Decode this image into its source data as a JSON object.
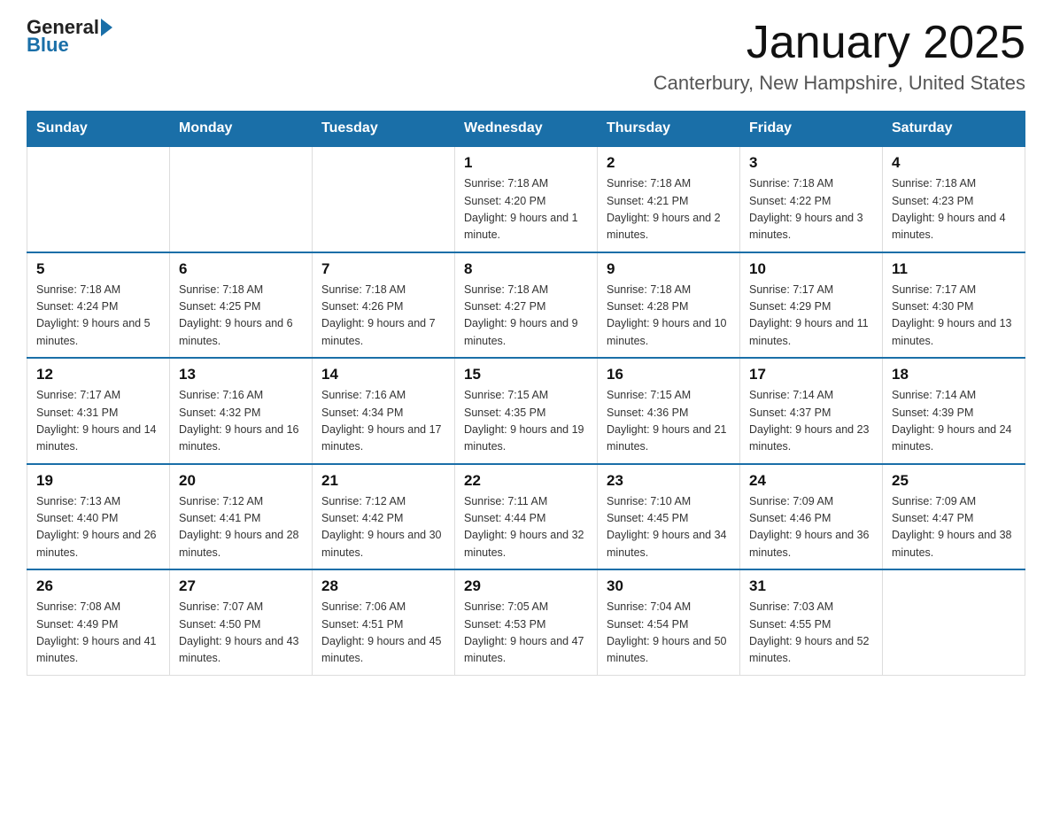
{
  "header": {
    "logo_text": "General",
    "logo_blue": "Blue",
    "title": "January 2025",
    "subtitle": "Canterbury, New Hampshire, United States"
  },
  "days_of_week": [
    "Sunday",
    "Monday",
    "Tuesday",
    "Wednesday",
    "Thursday",
    "Friday",
    "Saturday"
  ],
  "weeks": [
    [
      {
        "day": "",
        "info": ""
      },
      {
        "day": "",
        "info": ""
      },
      {
        "day": "",
        "info": ""
      },
      {
        "day": "1",
        "info": "Sunrise: 7:18 AM\nSunset: 4:20 PM\nDaylight: 9 hours and 1 minute."
      },
      {
        "day": "2",
        "info": "Sunrise: 7:18 AM\nSunset: 4:21 PM\nDaylight: 9 hours and 2 minutes."
      },
      {
        "day": "3",
        "info": "Sunrise: 7:18 AM\nSunset: 4:22 PM\nDaylight: 9 hours and 3 minutes."
      },
      {
        "day": "4",
        "info": "Sunrise: 7:18 AM\nSunset: 4:23 PM\nDaylight: 9 hours and 4 minutes."
      }
    ],
    [
      {
        "day": "5",
        "info": "Sunrise: 7:18 AM\nSunset: 4:24 PM\nDaylight: 9 hours and 5 minutes."
      },
      {
        "day": "6",
        "info": "Sunrise: 7:18 AM\nSunset: 4:25 PM\nDaylight: 9 hours and 6 minutes."
      },
      {
        "day": "7",
        "info": "Sunrise: 7:18 AM\nSunset: 4:26 PM\nDaylight: 9 hours and 7 minutes."
      },
      {
        "day": "8",
        "info": "Sunrise: 7:18 AM\nSunset: 4:27 PM\nDaylight: 9 hours and 9 minutes."
      },
      {
        "day": "9",
        "info": "Sunrise: 7:18 AM\nSunset: 4:28 PM\nDaylight: 9 hours and 10 minutes."
      },
      {
        "day": "10",
        "info": "Sunrise: 7:17 AM\nSunset: 4:29 PM\nDaylight: 9 hours and 11 minutes."
      },
      {
        "day": "11",
        "info": "Sunrise: 7:17 AM\nSunset: 4:30 PM\nDaylight: 9 hours and 13 minutes."
      }
    ],
    [
      {
        "day": "12",
        "info": "Sunrise: 7:17 AM\nSunset: 4:31 PM\nDaylight: 9 hours and 14 minutes."
      },
      {
        "day": "13",
        "info": "Sunrise: 7:16 AM\nSunset: 4:32 PM\nDaylight: 9 hours and 16 minutes."
      },
      {
        "day": "14",
        "info": "Sunrise: 7:16 AM\nSunset: 4:34 PM\nDaylight: 9 hours and 17 minutes."
      },
      {
        "day": "15",
        "info": "Sunrise: 7:15 AM\nSunset: 4:35 PM\nDaylight: 9 hours and 19 minutes."
      },
      {
        "day": "16",
        "info": "Sunrise: 7:15 AM\nSunset: 4:36 PM\nDaylight: 9 hours and 21 minutes."
      },
      {
        "day": "17",
        "info": "Sunrise: 7:14 AM\nSunset: 4:37 PM\nDaylight: 9 hours and 23 minutes."
      },
      {
        "day": "18",
        "info": "Sunrise: 7:14 AM\nSunset: 4:39 PM\nDaylight: 9 hours and 24 minutes."
      }
    ],
    [
      {
        "day": "19",
        "info": "Sunrise: 7:13 AM\nSunset: 4:40 PM\nDaylight: 9 hours and 26 minutes."
      },
      {
        "day": "20",
        "info": "Sunrise: 7:12 AM\nSunset: 4:41 PM\nDaylight: 9 hours and 28 minutes."
      },
      {
        "day": "21",
        "info": "Sunrise: 7:12 AM\nSunset: 4:42 PM\nDaylight: 9 hours and 30 minutes."
      },
      {
        "day": "22",
        "info": "Sunrise: 7:11 AM\nSunset: 4:44 PM\nDaylight: 9 hours and 32 minutes."
      },
      {
        "day": "23",
        "info": "Sunrise: 7:10 AM\nSunset: 4:45 PM\nDaylight: 9 hours and 34 minutes."
      },
      {
        "day": "24",
        "info": "Sunrise: 7:09 AM\nSunset: 4:46 PM\nDaylight: 9 hours and 36 minutes."
      },
      {
        "day": "25",
        "info": "Sunrise: 7:09 AM\nSunset: 4:47 PM\nDaylight: 9 hours and 38 minutes."
      }
    ],
    [
      {
        "day": "26",
        "info": "Sunrise: 7:08 AM\nSunset: 4:49 PM\nDaylight: 9 hours and 41 minutes."
      },
      {
        "day": "27",
        "info": "Sunrise: 7:07 AM\nSunset: 4:50 PM\nDaylight: 9 hours and 43 minutes."
      },
      {
        "day": "28",
        "info": "Sunrise: 7:06 AM\nSunset: 4:51 PM\nDaylight: 9 hours and 45 minutes."
      },
      {
        "day": "29",
        "info": "Sunrise: 7:05 AM\nSunset: 4:53 PM\nDaylight: 9 hours and 47 minutes."
      },
      {
        "day": "30",
        "info": "Sunrise: 7:04 AM\nSunset: 4:54 PM\nDaylight: 9 hours and 50 minutes."
      },
      {
        "day": "31",
        "info": "Sunrise: 7:03 AM\nSunset: 4:55 PM\nDaylight: 9 hours and 52 minutes."
      },
      {
        "day": "",
        "info": ""
      }
    ]
  ]
}
